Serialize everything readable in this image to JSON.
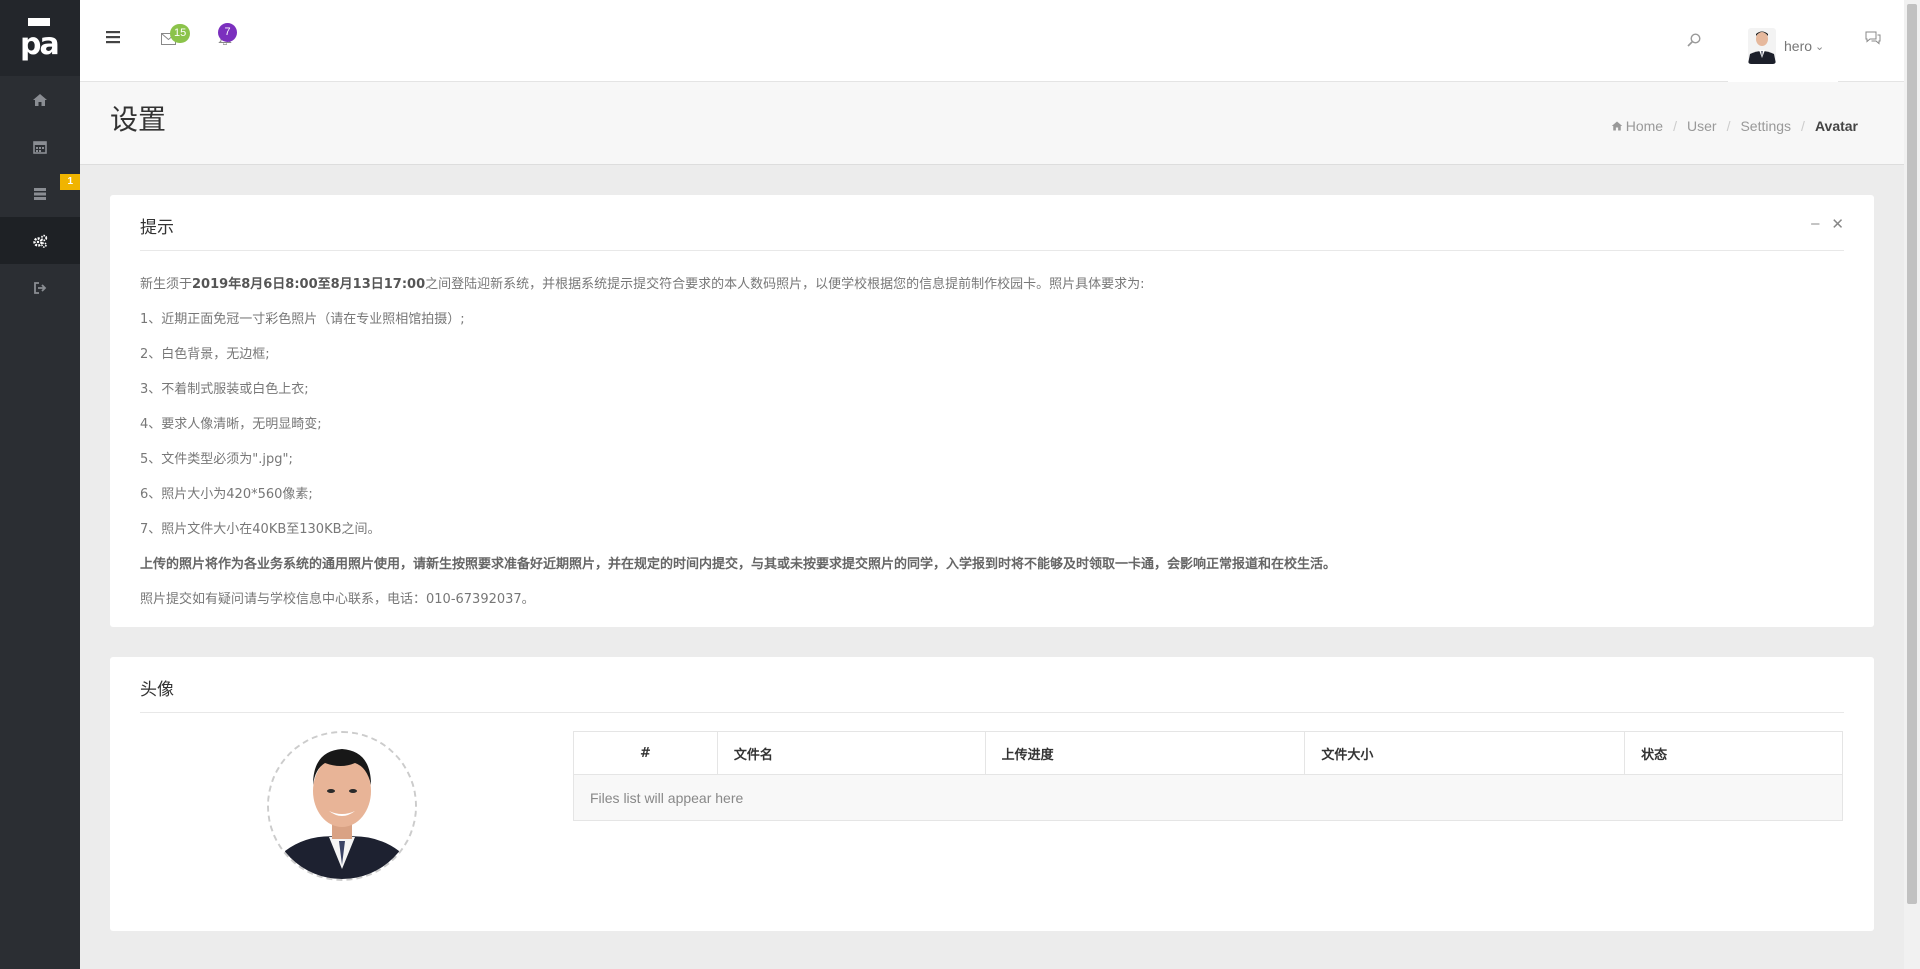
{
  "app": {
    "logo_text": "pa"
  },
  "sidebar": {
    "items": [
      {
        "name": "home",
        "icon": "home-icon"
      },
      {
        "name": "calendar",
        "icon": "calendar-icon"
      },
      {
        "name": "list",
        "icon": "server-icon",
        "badge": "1"
      },
      {
        "name": "settings",
        "icon": "gears-icon",
        "active": true
      },
      {
        "name": "logout",
        "icon": "sign-out-icon"
      }
    ]
  },
  "topbar": {
    "mail_badge": "15",
    "bell_badge": "7",
    "username": "hero",
    "colors": {
      "mail_badge": "#8bc34a",
      "bell_badge": "#7b2fbe"
    }
  },
  "page": {
    "title": "设置",
    "breadcrumb": [
      "Home",
      "User",
      "Settings",
      "Avatar"
    ]
  },
  "notice": {
    "title": "提示",
    "intro_pre": "新生须于",
    "intro_bold": "2019年8月6日8:00至8月13日17:00",
    "intro_post": "之间登陆迎新系统，并根据系统提示提交符合要求的本人数码照片，以便学校根据您的信息提前制作校园卡。照片具体要求为:",
    "rules": [
      "1、近期正面免冠一寸彩色照片（请在专业照相馆拍摄）;",
      "2、白色背景，无边框;",
      "3、不着制式服装或白色上衣;",
      "4、要求人像清晰，无明显畸变;",
      "5、文件类型必须为\".jpg\";",
      "6、照片大小为420*560像素;",
      "7、照片文件大小在40KB至130KB之间。"
    ],
    "warning": "上传的照片将作为各业务系统的通用照片使用，请新生按照要求准备好近期照片，并在规定的时间内提交，与其或未按要求提交照片的同学，入学报到时将不能够及时领取一卡通，会影响正常报道和在校生活。",
    "contact": "照片提交如有疑问请与学校信息中心联系，电话：010-67392037。"
  },
  "avatar_panel": {
    "title": "头像",
    "columns": [
      "#",
      "文件名",
      "上传进度",
      "文件大小",
      "状态"
    ],
    "empty_text": "Files list will appear here"
  }
}
